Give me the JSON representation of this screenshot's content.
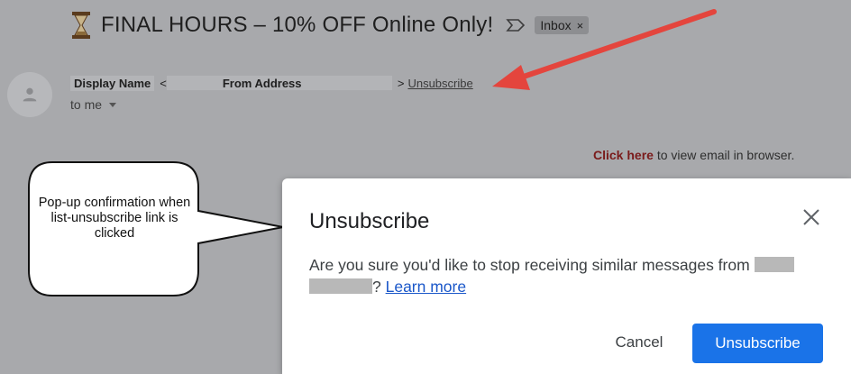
{
  "email": {
    "subject": "FINAL HOURS – 10% OFF Online Only!",
    "subject_icon": "hourglass-icon",
    "label_chip": "Inbox",
    "label_chip_close": "×",
    "display_name": "Display Name",
    "from_open": "<",
    "from_address": "From Address",
    "from_close": ">",
    "unsubscribe_link": "Unsubscribe",
    "recipient": "to me",
    "browser_link": "Click here",
    "browser_text": " to view email in browser."
  },
  "callout": {
    "text": "Pop-up confirmation when list-unsubscribe link is clicked"
  },
  "dialog": {
    "title": "Unsubscribe",
    "body_prefix": "Are you sure you'd like to stop receiving similar messages from ",
    "body_suffix": "? ",
    "learn_more": "Learn more",
    "cancel_label": "Cancel",
    "confirm_label": "Unsubscribe"
  },
  "colors": {
    "overlay": "#a8a9ac",
    "primary_button": "#1a73e8",
    "link": "#1a57c9",
    "annotation_arrow": "#e4453d",
    "click_here": "#7a1b1b"
  }
}
